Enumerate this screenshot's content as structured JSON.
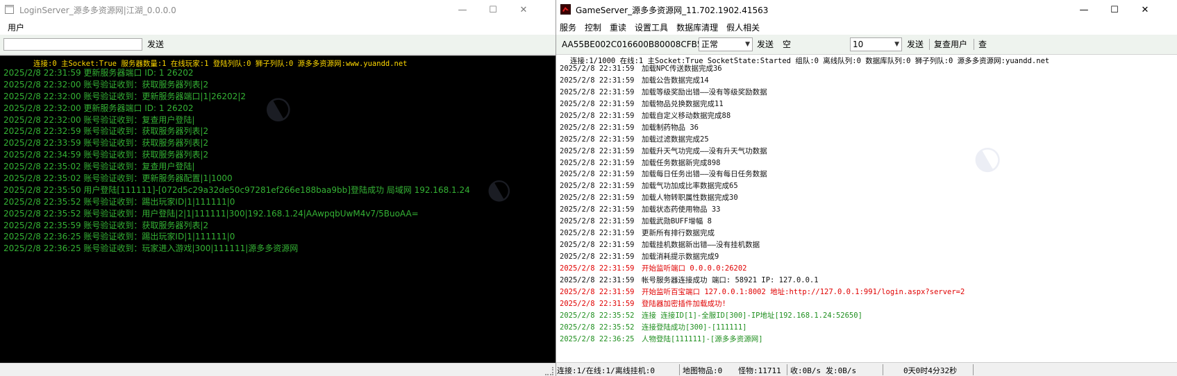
{
  "colors": {
    "left_log_bg": "#000000",
    "left_status_text": "#ffd800",
    "left_log_text": "#34b234",
    "right_log_red": "#e00000",
    "right_log_green": "#1f8f1f",
    "toolbar_bg": "#eef3ee"
  },
  "left_window": {
    "title": "LoginServer_源多多资源网|江湖_0.0.0.0",
    "icon": "window-icon",
    "controls": {
      "minimize": "—",
      "maximize": "☐",
      "close": "✕"
    },
    "menu": [
      "用户"
    ],
    "input_value": "",
    "send_label": "发送",
    "status": "连接:0 主Socket:True 服务器数量:1 在线玩家:1 登陆列队:0 狮子列队:0 源多多资源网:www.yuandd.net",
    "log": [
      "2025/2/8  22:31:59 更新服务器端口 ID: 1   26202",
      "2025/2/8  22:32:00 账号验证收到：获取服务器列表|2",
      "2025/2/8  22:32:00 账号验证收到：更新服务器端口|1|26202|2",
      "2025/2/8  22:32:00 更新服务器端口 ID: 1   26202",
      "2025/2/8  22:32:00 账号验证收到：复查用户登陆|",
      "2025/2/8  22:32:59 账号验证收到：获取服务器列表|2",
      "2025/2/8  22:33:59 账号验证收到：获取服务器列表|2",
      "2025/2/8  22:34:59 账号验证收到：获取服务器列表|2",
      "2025/2/8  22:35:02 账号验证收到：复查用户登陆|",
      "2025/2/8  22:35:02 账号验证收到：更新服务器配置|1|1000",
      "2025/2/8  22:35:50 用户登陆[111111]-[072d5c29a32de50c97281ef266e188baa9bb]登陆成功 局域网 192.168.1.24",
      "2025/2/8  22:35:52 账号验证收到：踢出玩家ID|1|111111|0",
      "2025/2/8  22:35:52 账号验证收到：用户登陆|2|1|111111|300|192.168.1.24|AAwpqbUwM4v7/5BuoAA=",
      "2025/2/8  22:35:59 账号验证收到：获取服务器列表|2",
      "2025/2/8  22:36:25 账号验证收到：踢出玩家ID|1|111111|0",
      "2025/2/8  22:36:25 账号验证收到：玩家进入游戏|300|111111|源多多资源网"
    ]
  },
  "right_window": {
    "title": "GameServer_源多多资源网_11.702.1902.41563",
    "icon": "game-app-icon",
    "controls": {
      "minimize": "—",
      "maximize": "☐",
      "close": "✕"
    },
    "menu": [
      "服务",
      "控制",
      "重读",
      "设置工具",
      "数据库清理",
      "假人相关"
    ],
    "toolbar": {
      "id_value": "AA55BE002C016600B80008CFB5C",
      "mode_select": "正常",
      "send1": "发送",
      "text_value": "空",
      "count_select": "10",
      "send2": "发送",
      "check_user": "复查用户",
      "query": "查"
    },
    "status": "连接:1/1000  在线:1  主Socket:True  SocketState:Started  组队:0  离线队列:0  数据库队列:0  狮子列队:0  源多多资源网:yuandd.net",
    "log": [
      {
        "ts": "2025/2/8  22:31:59",
        "msg": "加载NPC传送数据完成36",
        "color": "black"
      },
      {
        "ts": "2025/2/8  22:31:59",
        "msg": "加载公告数据完成14",
        "color": "black"
      },
      {
        "ts": "2025/2/8  22:31:59",
        "msg": "加载等级奖励出错——没有等级奖励数据",
        "color": "black"
      },
      {
        "ts": "2025/2/8  22:31:59",
        "msg": "加载物品兑换数据完成11",
        "color": "black"
      },
      {
        "ts": "2025/2/8  22:31:59",
        "msg": "加载自定义移动数据完成88",
        "color": "black"
      },
      {
        "ts": "2025/2/8  22:31:59",
        "msg": "加载制药物品 36",
        "color": "black"
      },
      {
        "ts": "2025/2/8  22:31:59",
        "msg": "加载过滤数据完成25",
        "color": "black"
      },
      {
        "ts": "2025/2/8  22:31:59",
        "msg": "加载升天气功完成——没有升天气功数据",
        "color": "black"
      },
      {
        "ts": "2025/2/8  22:31:59",
        "msg": "加载任务数据新完成898",
        "color": "black"
      },
      {
        "ts": "2025/2/8  22:31:59",
        "msg": "加载每日任务出错——没有每日任务数据",
        "color": "black"
      },
      {
        "ts": "2025/2/8  22:31:59",
        "msg": "加载气功加成比率数据完成65",
        "color": "black"
      },
      {
        "ts": "2025/2/8  22:31:59",
        "msg": "加载人物转职属性数据完成30",
        "color": "black"
      },
      {
        "ts": "2025/2/8  22:31:59",
        "msg": "加载状态药使用物品 33",
        "color": "black"
      },
      {
        "ts": "2025/2/8  22:31:59",
        "msg": "加载武勋BUFF增幅 8",
        "color": "black"
      },
      {
        "ts": "2025/2/8  22:31:59",
        "msg": "更新所有排行数据完成",
        "color": "black"
      },
      {
        "ts": "2025/2/8  22:31:59",
        "msg": "加载挂机数据新出错——没有挂机数据",
        "color": "black"
      },
      {
        "ts": "2025/2/8  22:31:59",
        "msg": "加载消耗提示数据完成9",
        "color": "black"
      },
      {
        "ts": "2025/2/8  22:31:59",
        "msg": "开始监听端口 0.0.0.0:26202",
        "color": "red"
      },
      {
        "ts": "2025/2/8  22:31:59",
        "msg": "帐号服务器连接成功       端口: 58921      IP: 127.0.0.1",
        "color": "black"
      },
      {
        "ts": "2025/2/8  22:31:59",
        "msg": "开始监听百宝端口 127.0.0.1:8002 地址:http://127.0.0.1:991/login.aspx?server=2",
        "color": "red"
      },
      {
        "ts": "2025/2/8  22:31:59",
        "msg": "登陆器加密插件加载成功!",
        "color": "red"
      },
      {
        "ts": "2025/2/8  22:35:52",
        "msg": "连接 连接ID[1]-全服ID[300]-IP地址[192.168.1.24:52650]",
        "color": "green"
      },
      {
        "ts": "2025/2/8  22:35:52",
        "msg": "连接登陆成功[300]-[111111]",
        "color": "green"
      },
      {
        "ts": "2025/2/8  22:36:25",
        "msg": "人物登陆[111111]-[源多多资源网]",
        "color": "green"
      }
    ],
    "statusbar": {
      "conn": "连接:1/在线:1/离线挂机:0",
      "map_items": "地图物品:0",
      "monsters": "怪物:11711",
      "recv": "收:0B/s",
      "send": "发:0B/s",
      "uptime": "0天0时4分32秒"
    }
  }
}
